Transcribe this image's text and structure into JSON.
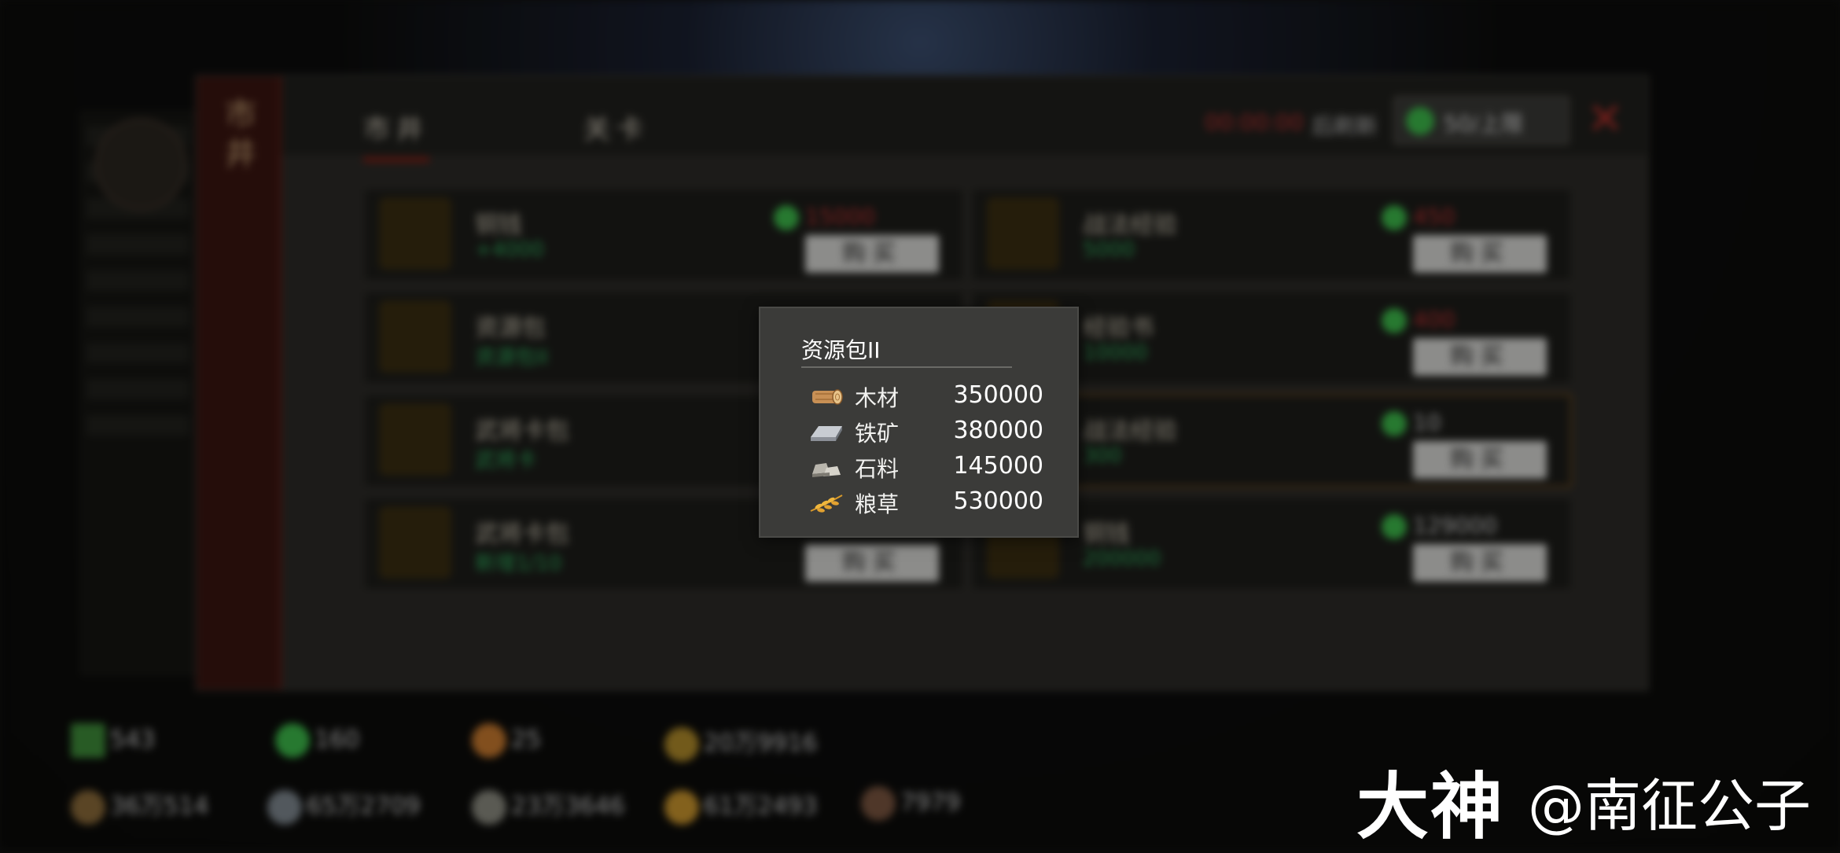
{
  "background": {
    "side_tab_label": "市井",
    "tabs": [
      {
        "label": "市井",
        "active": true
      },
      {
        "label": "关卡",
        "active": false
      }
    ],
    "refresh_timer": "00:00:00",
    "refresh_label": "后刷新",
    "refresh_button": "50/上限",
    "close_label": "✕",
    "buy_label": "购买",
    "items": [
      {
        "name": "铜钱",
        "sub": "+4000",
        "price": "15000",
        "price_style": "red"
      },
      {
        "name": "战法经验",
        "sub": "5000",
        "price": "450",
        "price_style": "red"
      },
      {
        "name": "资源包",
        "sub": "资源包II",
        "price": "",
        "price_style": "red"
      },
      {
        "name": "经验书",
        "sub": "10000",
        "price": "400",
        "price_style": "red"
      },
      {
        "name": "武将卡包",
        "sub": "武将卡",
        "price": "",
        "price_style": "red"
      },
      {
        "name": "战法经验",
        "sub": "300",
        "price": "10",
        "price_style": "white"
      },
      {
        "name": "武将卡包",
        "sub": "新增1/10",
        "price": "",
        "price_style": "red"
      },
      {
        "name": "铜钱",
        "sub": "200000",
        "price": "129000",
        "price_style": "white"
      }
    ],
    "resources_top": [
      "543",
      "160",
      "25",
      "20万9916"
    ],
    "resources_bottom": [
      "36万514",
      "65万2709",
      "23万3646",
      "61万2493",
      "7979"
    ]
  },
  "tooltip": {
    "title": "资源包II",
    "rows": [
      {
        "icon": "wood-icon",
        "label": "木材",
        "value": "350000"
      },
      {
        "icon": "iron-icon",
        "label": "铁矿",
        "value": "380000"
      },
      {
        "icon": "stone-icon",
        "label": "石料",
        "value": "145000"
      },
      {
        "icon": "grain-icon",
        "label": "粮草",
        "value": "530000"
      }
    ]
  },
  "watermark": {
    "brand": "大神",
    "author": "@南征公子"
  },
  "colors": {
    "tooltip_bg": "#3b3b39",
    "jade": "#3dbb4b",
    "price_red": "#c03030",
    "sub_green": "#2fae5c"
  }
}
